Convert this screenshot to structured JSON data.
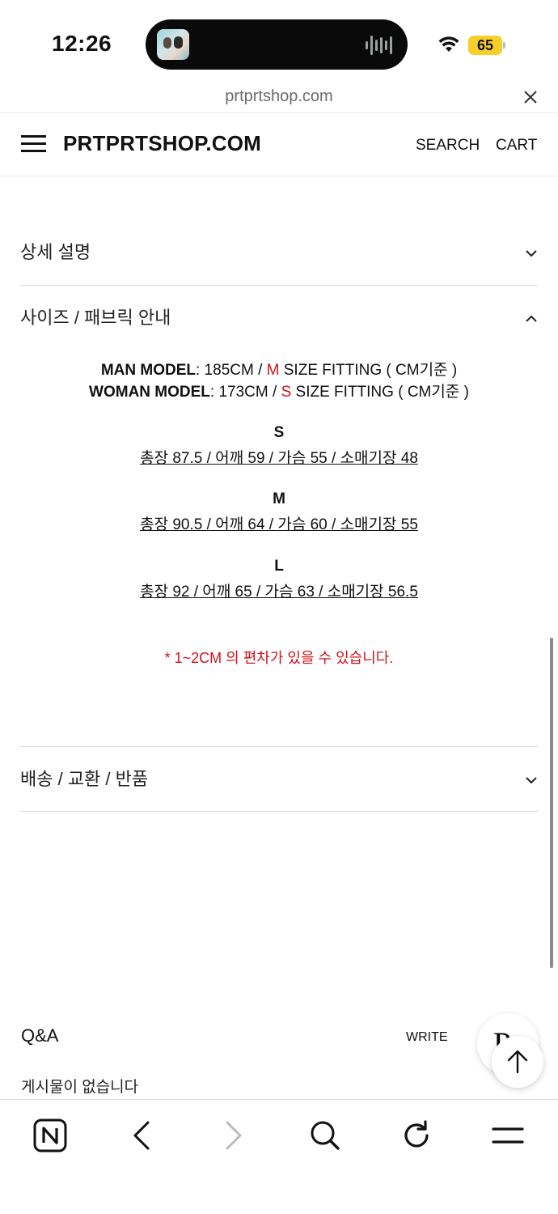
{
  "status_bar": {
    "time": "12:26",
    "battery": "65",
    "battery_color": "#f6cf2a"
  },
  "browser": {
    "url": "prtprtshop.com",
    "close_icon": "close-icon"
  },
  "header": {
    "logo": "PRTPRTSHOP.COM",
    "search_label": "SEARCH",
    "cart_label": "CART",
    "menu_icon": "hamburger-menu-icon"
  },
  "accordion": [
    {
      "title": "상세 설명",
      "state": "collapsed"
    },
    {
      "title": "사이즈 / 패브릭 안내",
      "state": "expanded"
    },
    {
      "title": "배송 / 교환 / 반품",
      "state": "collapsed"
    }
  ],
  "size_guide": {
    "man": {
      "label": "MAN MODEL",
      "text": ": 185CM / ",
      "size": "M",
      "fitting": " SIZE FITTING ( CM기준 )"
    },
    "woman": {
      "label": "WOMAN MODEL",
      "text": ": 173CM / ",
      "size": "S",
      "fitting": " SIZE FITTING ( CM기준 )"
    },
    "sizes": [
      {
        "name": "S",
        "spec": "총장 87.5 / 어깨 59 / 가슴 55 / 소매기장 48"
      },
      {
        "name": "M",
        "spec": "총장 90.5 / 어깨 64 / 가슴 60 / 소매기장 55"
      },
      {
        "name": "L",
        "spec": "총장 92 / 어깨 65 / 가슴 63 / 소매기장 56.5"
      }
    ],
    "note": "* 1~2CM 의 편차가 있을 수 있습니다.",
    "accent_color": "#d0141b"
  },
  "qa": {
    "title": "Q&A",
    "write_label": "WRITE",
    "empty_text": "게시물이 없습니다"
  },
  "floating": {
    "logo_letter": "P",
    "top_icon": "arrow-up-icon"
  },
  "toolbar": {
    "icons": [
      "naver-home-icon",
      "back-icon",
      "forward-icon",
      "search-icon",
      "reload-icon",
      "menu-icon"
    ]
  }
}
